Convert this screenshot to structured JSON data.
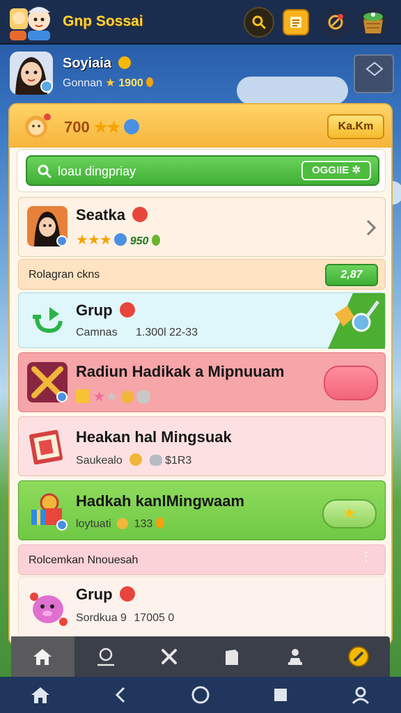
{
  "app": {
    "title": "Gnp Sossai"
  },
  "topbar": {
    "icons": [
      "search-icon",
      "notes-icon",
      "compass-icon",
      "chest-icon"
    ]
  },
  "profile": {
    "name": "Soyiaia",
    "subtitle": "Gonnan",
    "coins": "1900"
  },
  "panel": {
    "header_count": "700",
    "header_button": "Ka.Km",
    "search": {
      "placeholder": "loau dingpriay",
      "button": "OGGIIE"
    },
    "rows": [
      {
        "title": "Seatka",
        "meta": "950"
      },
      {
        "title": "Grup",
        "subtitle": "Camnas",
        "meta": "1.300l 22-33"
      },
      {
        "title": "Radiun Hadikak a Mipnuuam"
      },
      {
        "title": "Heakan hal Mingsuak",
        "subtitle": "Saukealo",
        "meta": "$1R3"
      },
      {
        "title": "Hadkah kanlMingwaam",
        "subtitle": "loytuati",
        "meta": "133"
      },
      {
        "title": "Grup",
        "subtitle": "Sordkua 9",
        "meta": "17005 0"
      }
    ],
    "sections": [
      {
        "label": "Rolagran ckns",
        "button": "2,87"
      },
      {
        "label": "Rolcemkan Nnouesah"
      }
    ]
  },
  "navbar": {
    "items": [
      "home-icon",
      "profile-icon",
      "tools-icon",
      "bag-icon",
      "leaderboard-icon",
      "compass-icon"
    ]
  },
  "system_nav": {
    "items": [
      "home-icon",
      "back-icon",
      "circle-icon",
      "square-icon",
      "person-icon"
    ]
  },
  "colors": {
    "accent": "#ffd23d",
    "panel_header": "#f6b43b",
    "green": "#3fae35",
    "pink": "#f6a5a8",
    "cyan": "#dff6fb"
  }
}
